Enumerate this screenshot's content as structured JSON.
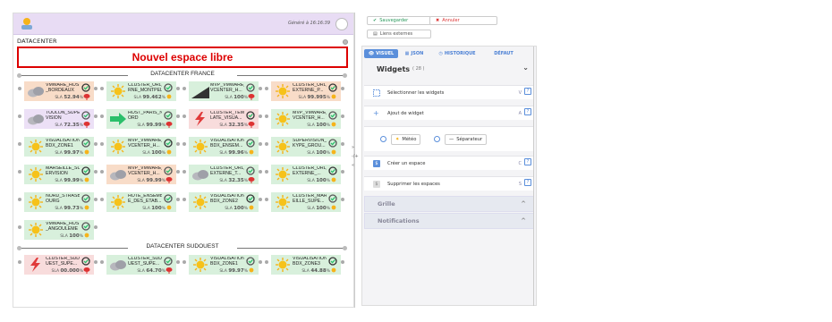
{
  "header": {
    "generated": "Généré à 16:16:39"
  },
  "datacenter_title": "DATACENTER",
  "free_zone": "Nouvel espace libre",
  "sections": [
    {
      "label": "DATACENTER FRANCE"
    },
    {
      "label": "DATACENTER SUDOUEST"
    }
  ],
  "tiles_fr": [
    {
      "name": "VMWARE_HOST _BORDEAUX",
      "value": "52.94",
      "unit": "%",
      "prefix": "SLA",
      "weather": "cloud",
      "color": "#f8dcc8"
    },
    {
      "name": "CLUSTER_URL_EXTE RNE_MONTPELIER",
      "value": "99.462",
      "unit": "%",
      "prefix": "SLA",
      "weather": "sun",
      "color": "#d8f0dc"
    },
    {
      "name": "MVP_VMWARE_ VCENTER_H...",
      "value": "100",
      "unit": "%",
      "prefix": "SLA",
      "weather": "storm",
      "color": "#d8f0dc"
    },
    {
      "name": "CLUSTER_URL_ EXTERNE_P...",
      "value": "99.995",
      "unit": "%",
      "prefix": "SLA",
      "weather": "sun",
      "color": "#f8dcc8"
    },
    {
      "name": "TOULON_SUPER VISION",
      "value": "72.35",
      "unit": "%",
      "prefix": "SLA",
      "weather": "cloud",
      "color": "#ece0f6"
    },
    {
      "name": "HOST_PARIS_N ORD",
      "value": "99.99",
      "unit": "%",
      "prefix": "SLA",
      "weather": "arrow",
      "color": "#d8f0dc"
    },
    {
      "name": "CLUSTER_TEMP LATE_VISUA...",
      "value": "32.35",
      "unit": "%",
      "prefix": "SLA",
      "weather": "bolt",
      "color": "#f8dcdc"
    },
    {
      "name": "MVP_VMWARE_ VCENTER_H...",
      "value": "100",
      "unit": "%",
      "prefix": "SLA",
      "weather": "sun",
      "color": "#d8f0dc"
    },
    {
      "name": "VISUALISATION_ BDX_ZONE1",
      "value": "99.97",
      "unit": "%",
      "prefix": "SLA",
      "weather": "sun",
      "color": "#d8f0dc"
    },
    {
      "name": "MVP_VMWARE_ VCENTER_H...",
      "value": "100",
      "unit": "%",
      "prefix": "SLA",
      "weather": "sun",
      "color": "#d8f0dc"
    },
    {
      "name": "VISUALISATION_ BDX_ENSEM...",
      "value": "99.96",
      "unit": "%",
      "prefix": "SLA",
      "weather": "sun",
      "color": "#d8f0dc"
    },
    {
      "name": "SUPERVISION_S KYPE_GROU...",
      "value": "100",
      "unit": "%",
      "prefix": "SLA",
      "weather": "sun",
      "color": "#d8f0dc"
    },
    {
      "name": "MARSEILLE_SUP ERVISION",
      "value": "99.99",
      "unit": "%",
      "prefix": "SLA",
      "weather": "sun",
      "color": "#d8f0dc"
    },
    {
      "name": "MVP_VMWARE_ VCENTER_H...",
      "value": "99.99",
      "unit": "%",
      "prefix": "SLA",
      "weather": "cloud",
      "color": "#f8dcc8"
    },
    {
      "name": "CLUSTER_URL_ EXTERNE_T...",
      "value": "32.35",
      "unit": "%",
      "prefix": "SLA",
      "weather": "cloud",
      "color": "#d8f0dc"
    },
    {
      "name": "CLUSTER_URL_ EXTERNE_...",
      "value": "100",
      "unit": "%",
      "prefix": "SLA",
      "weather": "sun",
      "color": "#d8f0dc"
    },
    {
      "name": "NORD_STRASB OURG",
      "value": "99.73",
      "unit": "%",
      "prefix": "SLA",
      "weather": "sun",
      "color": "#d8f0dc"
    },
    {
      "name": "HOTE_ENSEMBL E_DES_ETAB...",
      "value": "100",
      "unit": "%",
      "prefix": "SLA",
      "weather": "sun",
      "color": "#d8f0dc"
    },
    {
      "name": "VISUALISATION_ BDX_ZONE2",
      "value": "100",
      "unit": "%",
      "prefix": "SLA",
      "weather": "sun",
      "color": "#d8f0dc"
    },
    {
      "name": "CLUSTER_MARS EILLE_SUPE...",
      "value": "100",
      "unit": "%",
      "prefix": "SLA",
      "weather": "sun",
      "color": "#d8f0dc"
    },
    {
      "name": "VMWARE_HOST _ANGOULEME",
      "value": "100",
      "unit": "%",
      "prefix": "SLA",
      "weather": "sun",
      "color": "#d8f0dc"
    }
  ],
  "tiles_so": [
    {
      "name": "CLUSTER_SUDO UEST_SUPE...",
      "value": "00.000",
      "unit": "%",
      "prefix": "SLA",
      "weather": "bolt",
      "color": "#f8dcdc"
    },
    {
      "name": "CLUSTER_SUDO UEST_SUPE...",
      "value": "64.70",
      "unit": "%",
      "prefix": "SLA",
      "weather": "cloud",
      "color": "#d8f0dc"
    },
    {
      "name": "VISUALISATION_ BDX_ZONE1",
      "value": "99.97",
      "unit": "%",
      "prefix": "SLA",
      "weather": "sun",
      "color": "#d8f0dc"
    },
    {
      "name": "VISUALISATION_ BDX_ZONE3",
      "value": "44.88",
      "unit": "%",
      "prefix": "SLA",
      "weather": "sun",
      "color": "#d8f0dc"
    }
  ],
  "actions": {
    "save": "Sauvegarder",
    "cancel": "Annuler",
    "links": "Liens externes"
  },
  "tabs": [
    {
      "label": "VISUEL",
      "icon": "eye-icon"
    },
    {
      "label": "JSON",
      "icon": "code-icon"
    },
    {
      "label": "HISTORIQUE",
      "icon": "history-icon"
    },
    {
      "label": "DÉFAUT",
      "icon": ""
    }
  ],
  "widgets": {
    "title": "Widgets",
    "count": "( 28 )",
    "rows": [
      {
        "label": "Sélectionner les widgets",
        "key": "V",
        "icon": "select-icon"
      },
      {
        "label": "Ajout de widget",
        "key": "A",
        "icon": "plus-icon"
      }
    ],
    "options": [
      {
        "label": "Météo"
      },
      {
        "label": "Séparateur"
      }
    ],
    "rows2": [
      {
        "label": "Créer un espace",
        "key": "C",
        "icon": "space-icon"
      },
      {
        "label": "Supprimer les espaces",
        "key": "S",
        "icon": "delete-space-icon"
      }
    ]
  },
  "accordions": [
    {
      "label": "Grille"
    },
    {
      "label": "Notifications"
    }
  ],
  "mid_controls": {
    "expand": "»",
    "zoom": "-/+",
    "collapse": "«"
  },
  "colors": {
    "accent": "#5b8fdb",
    "danger": "#dd0000",
    "ok": "#2a9a5c"
  }
}
